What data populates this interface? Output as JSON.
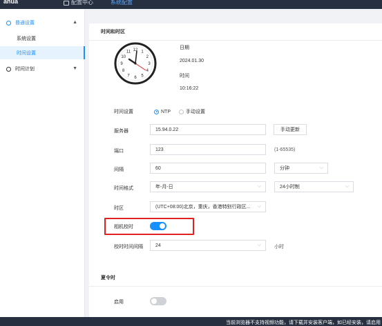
{
  "topbar": {
    "logo": "ahua",
    "items": [
      {
        "label": "配置中心"
      },
      {
        "label": "系统配置"
      }
    ]
  },
  "sidebar": {
    "groups": [
      {
        "label": "普通设置",
        "expanded": true,
        "items": [
          {
            "label": "系统设置"
          },
          {
            "label": "时间设置",
            "active": true
          }
        ]
      },
      {
        "label": "时间计划",
        "expanded": false
      }
    ]
  },
  "time_panel": {
    "title": "时间和时区",
    "date_label": "日期",
    "date_value": "2024.01.30",
    "time_label": "时间",
    "time_value": "10:16:22",
    "clock_numbers": [
      "12",
      "1",
      "2",
      "3",
      "4",
      "5",
      "6",
      "7",
      "8",
      "9",
      "10",
      "11"
    ],
    "time_setting": {
      "label": "时间设置",
      "options": [
        "NTP",
        "手动设置"
      ],
      "selected": "NTP"
    },
    "server": {
      "label": "服务器",
      "value": "15.94.0.22",
      "button": "手动更新"
    },
    "port": {
      "label": "端口",
      "value": "123",
      "range": "(1-65535)"
    },
    "interval": {
      "label": "间隔",
      "value": "60",
      "unit": "分钟"
    },
    "time_format": {
      "label": "时间格式",
      "date_format": "年-月-日",
      "hour_format": "24小时制"
    },
    "timezone": {
      "label": "时区",
      "value": "(UTC+08:00)北京，重庆，香港特别行政区..."
    },
    "camera_sync": {
      "label": "相机校时",
      "enabled": true
    },
    "sync_interval": {
      "label": "校时时间间隔",
      "value": "24",
      "unit": "小时"
    }
  },
  "dst_panel": {
    "title": "夏令时",
    "enable_label": "启用",
    "enabled": false
  },
  "bottombar": {
    "text": "当前浏览器不支持视频功能，请下载并安装客户端，如已经安装，请启用"
  },
  "colors": {
    "accent": "#1890ff",
    "highlight": "#e02020",
    "topbar": "#263040"
  }
}
